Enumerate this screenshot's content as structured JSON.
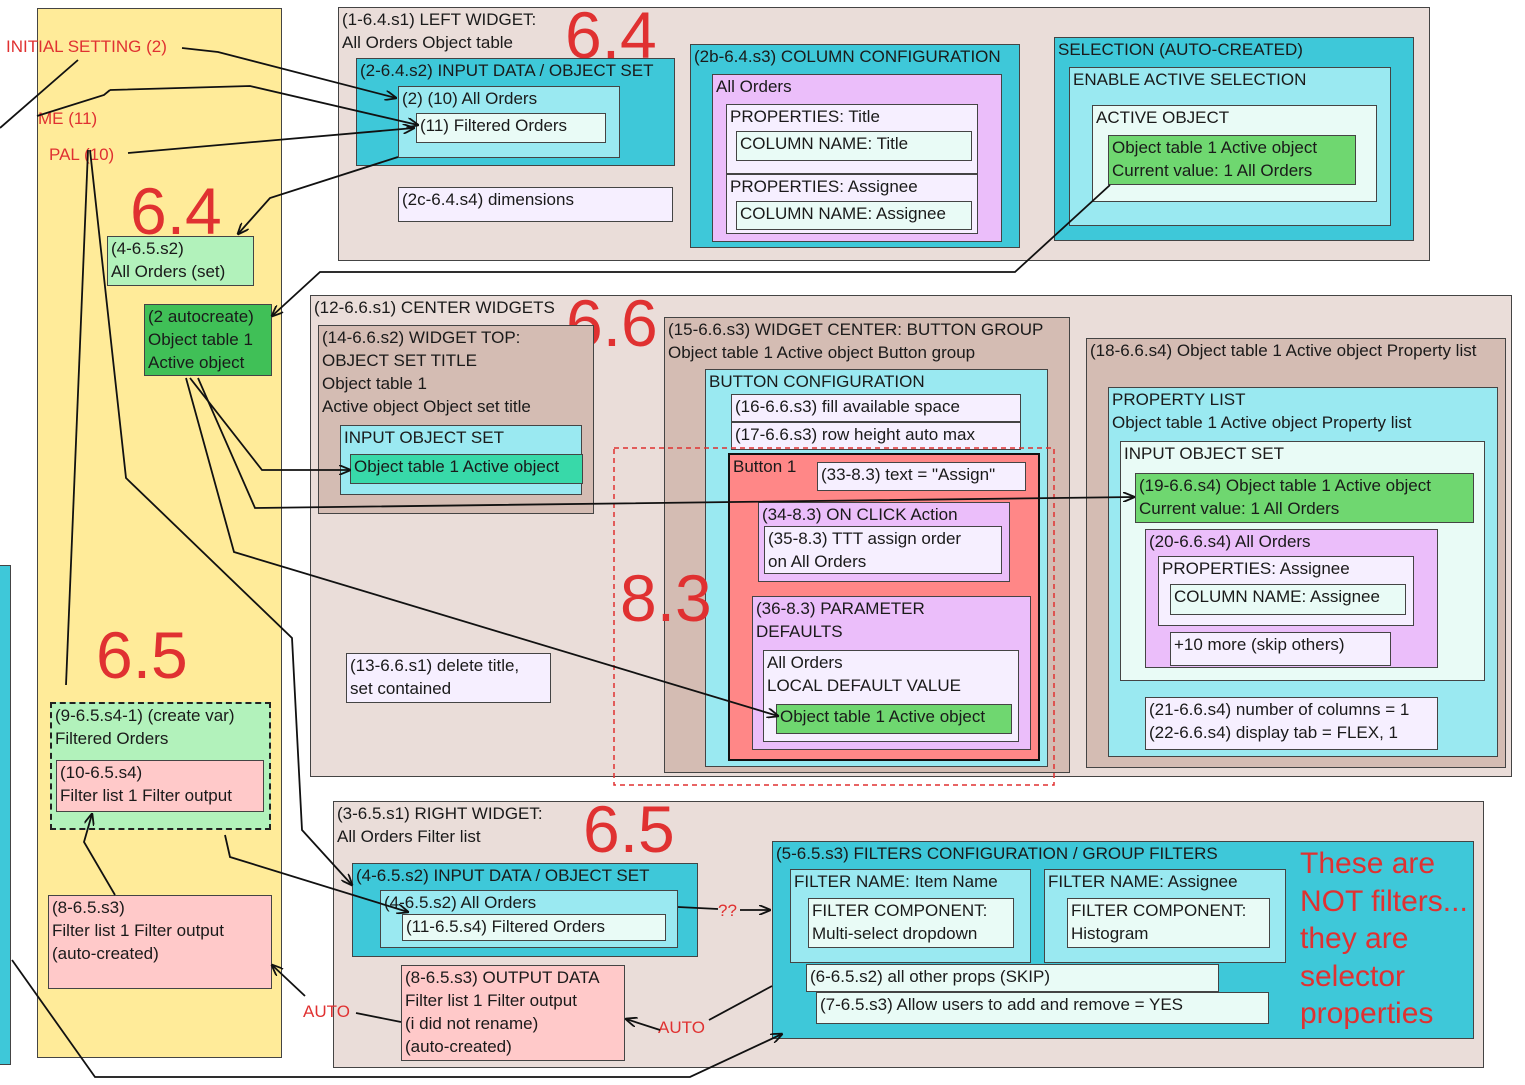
{
  "canvas": {
    "labels": {
      "initial_setting": "INITIAL SETTING (2)",
      "me": "ME (11)",
      "pal": "PAL (10)",
      "q": "??",
      "auto1": "AUTO",
      "auto2": "AUTO",
      "note": "These are NOT filters... they are selector properties"
    },
    "section_numbers": {
      "s64a": "6.4",
      "s64b": "6.4",
      "s66": "6.6",
      "s65a": "6.5",
      "s65b": "6.5",
      "s83": "8.3"
    }
  },
  "left_panel": {
    "set_box": "(4-6.5.s2)\nAll Orders (set)",
    "autocreate": "(2 autocreate)\nObject table 1\nActive object",
    "create_var": "(9-6.5.s4-1) (create var)\nFiltered Orders",
    "filter_out_a": "(10-6.5.s4)\nFilter list 1 Filter output",
    "filter_out_b": "(8-6.5.s3)\nFilter list 1 Filter output\n(auto-created)"
  },
  "top_widget": {
    "title": "(1-6.4.s1) LEFT WIDGET:\nAll Orders Object table",
    "input": "(2-6.4.s2) INPUT DATA / OBJECT SET",
    "all_orders": "(2) (10) All Orders",
    "filtered": "(11) Filtered Orders",
    "dims": "(2c-6.4.s4) dimensions",
    "colcfg": "(2b-6.4.s3) COLUMN CONFIGURATION",
    "col_all": "All Orders",
    "props_title": "PROPERTIES: Title",
    "colname_title": "COLUMN NAME: Title",
    "props_assignee": "PROPERTIES: Assignee",
    "colname_assignee": "COLUMN NAME: Assignee",
    "sel": "SELECTION (AUTO-CREATED)",
    "enable": "ENABLE ACTIVE SELECTION",
    "active": "ACTIVE OBJECT",
    "active_val": "Object table 1 Active object\nCurrent value: 1 All Orders"
  },
  "center": {
    "title": "(12-6.6.s1) CENTER WIDGETS",
    "top_title": "(14-6.6.s2) WIDGET TOP:\nOBJECT SET TITLE\nObject table 1\nActive object Object set title",
    "input_os": "INPUT OBJECT SET",
    "active_obj": "Object table 1 Active object",
    "delete_title": "(13-6.6.s1) delete title,\nset contained",
    "btn_group": "(15-6.6.s3) WIDGET CENTER: BUTTON GROUP\nObject table 1 Active object Button group",
    "btn_cfg": "BUTTON CONFIGURATION",
    "fill": "(16-6.6.s3) fill available space",
    "row": "(17-6.6.s3) row height auto max",
    "button1": "Button 1",
    "text": "(33-8.3) text = \"Assign\"",
    "onclick": "(34-8.3) ON CLICK Action",
    "ttt": "(35-8.3) TTT assign order\non All Orders",
    "param": "(36-8.3) PARAMETER\nDEFAULTS",
    "local": "All Orders\nLOCAL DEFAULT VALUE",
    "param_val": "Object table 1 Active object",
    "plist": "(18-6.6.s4) Object table 1 Active object Property list",
    "plist_inner": "PROPERTY LIST\nObject table 1 Active object Property list",
    "plist_input": "INPUT OBJECT SET",
    "plist_val": "(19-6.6.s4) Object table 1 Active object\nCurrent value: 1 All Orders",
    "plist_all": "(20-6.6.s4) All Orders",
    "plist_props": "PROPERTIES: Assignee",
    "plist_col": "COLUMN NAME: Assignee",
    "plist_more": "+10 more (skip others)",
    "plist_cols": "(21-6.6.s4) number of columns = 1\n(22-6.6.s4) display tab = FLEX, 1"
  },
  "right_widget": {
    "title": "(3-6.5.s1) RIGHT WIDGET:\nAll Orders Filter list",
    "input": "(4-6.5.s2) INPUT DATA / OBJECT SET",
    "all": "(4-6.5.s2) All Orders",
    "filtered": "(11-6.5.s4) Filtered Orders",
    "output": "(8-6.5.s3) OUTPUT DATA\nFilter list 1 Filter output\n(i did not rename)\n(auto-created)",
    "filters": "(5-6.5.s3) FILTERS CONFIGURATION / GROUP FILTERS",
    "f1": "FILTER NAME: Item Name",
    "f1c": "FILTER COMPONENT:\nMulti-select dropdown",
    "f2": "FILTER NAME: Assignee",
    "f2c": "FILTER COMPONENT:\nHistogram",
    "other": "(6-6.5.s2) all other props (SKIP)",
    "allow": "(7-6.5.s3) Allow users to add and remove = YES"
  },
  "colors": {
    "red_annotation": "#e03131",
    "yellow_panel": "#ffeb99",
    "teal": "#3ec8d9"
  }
}
